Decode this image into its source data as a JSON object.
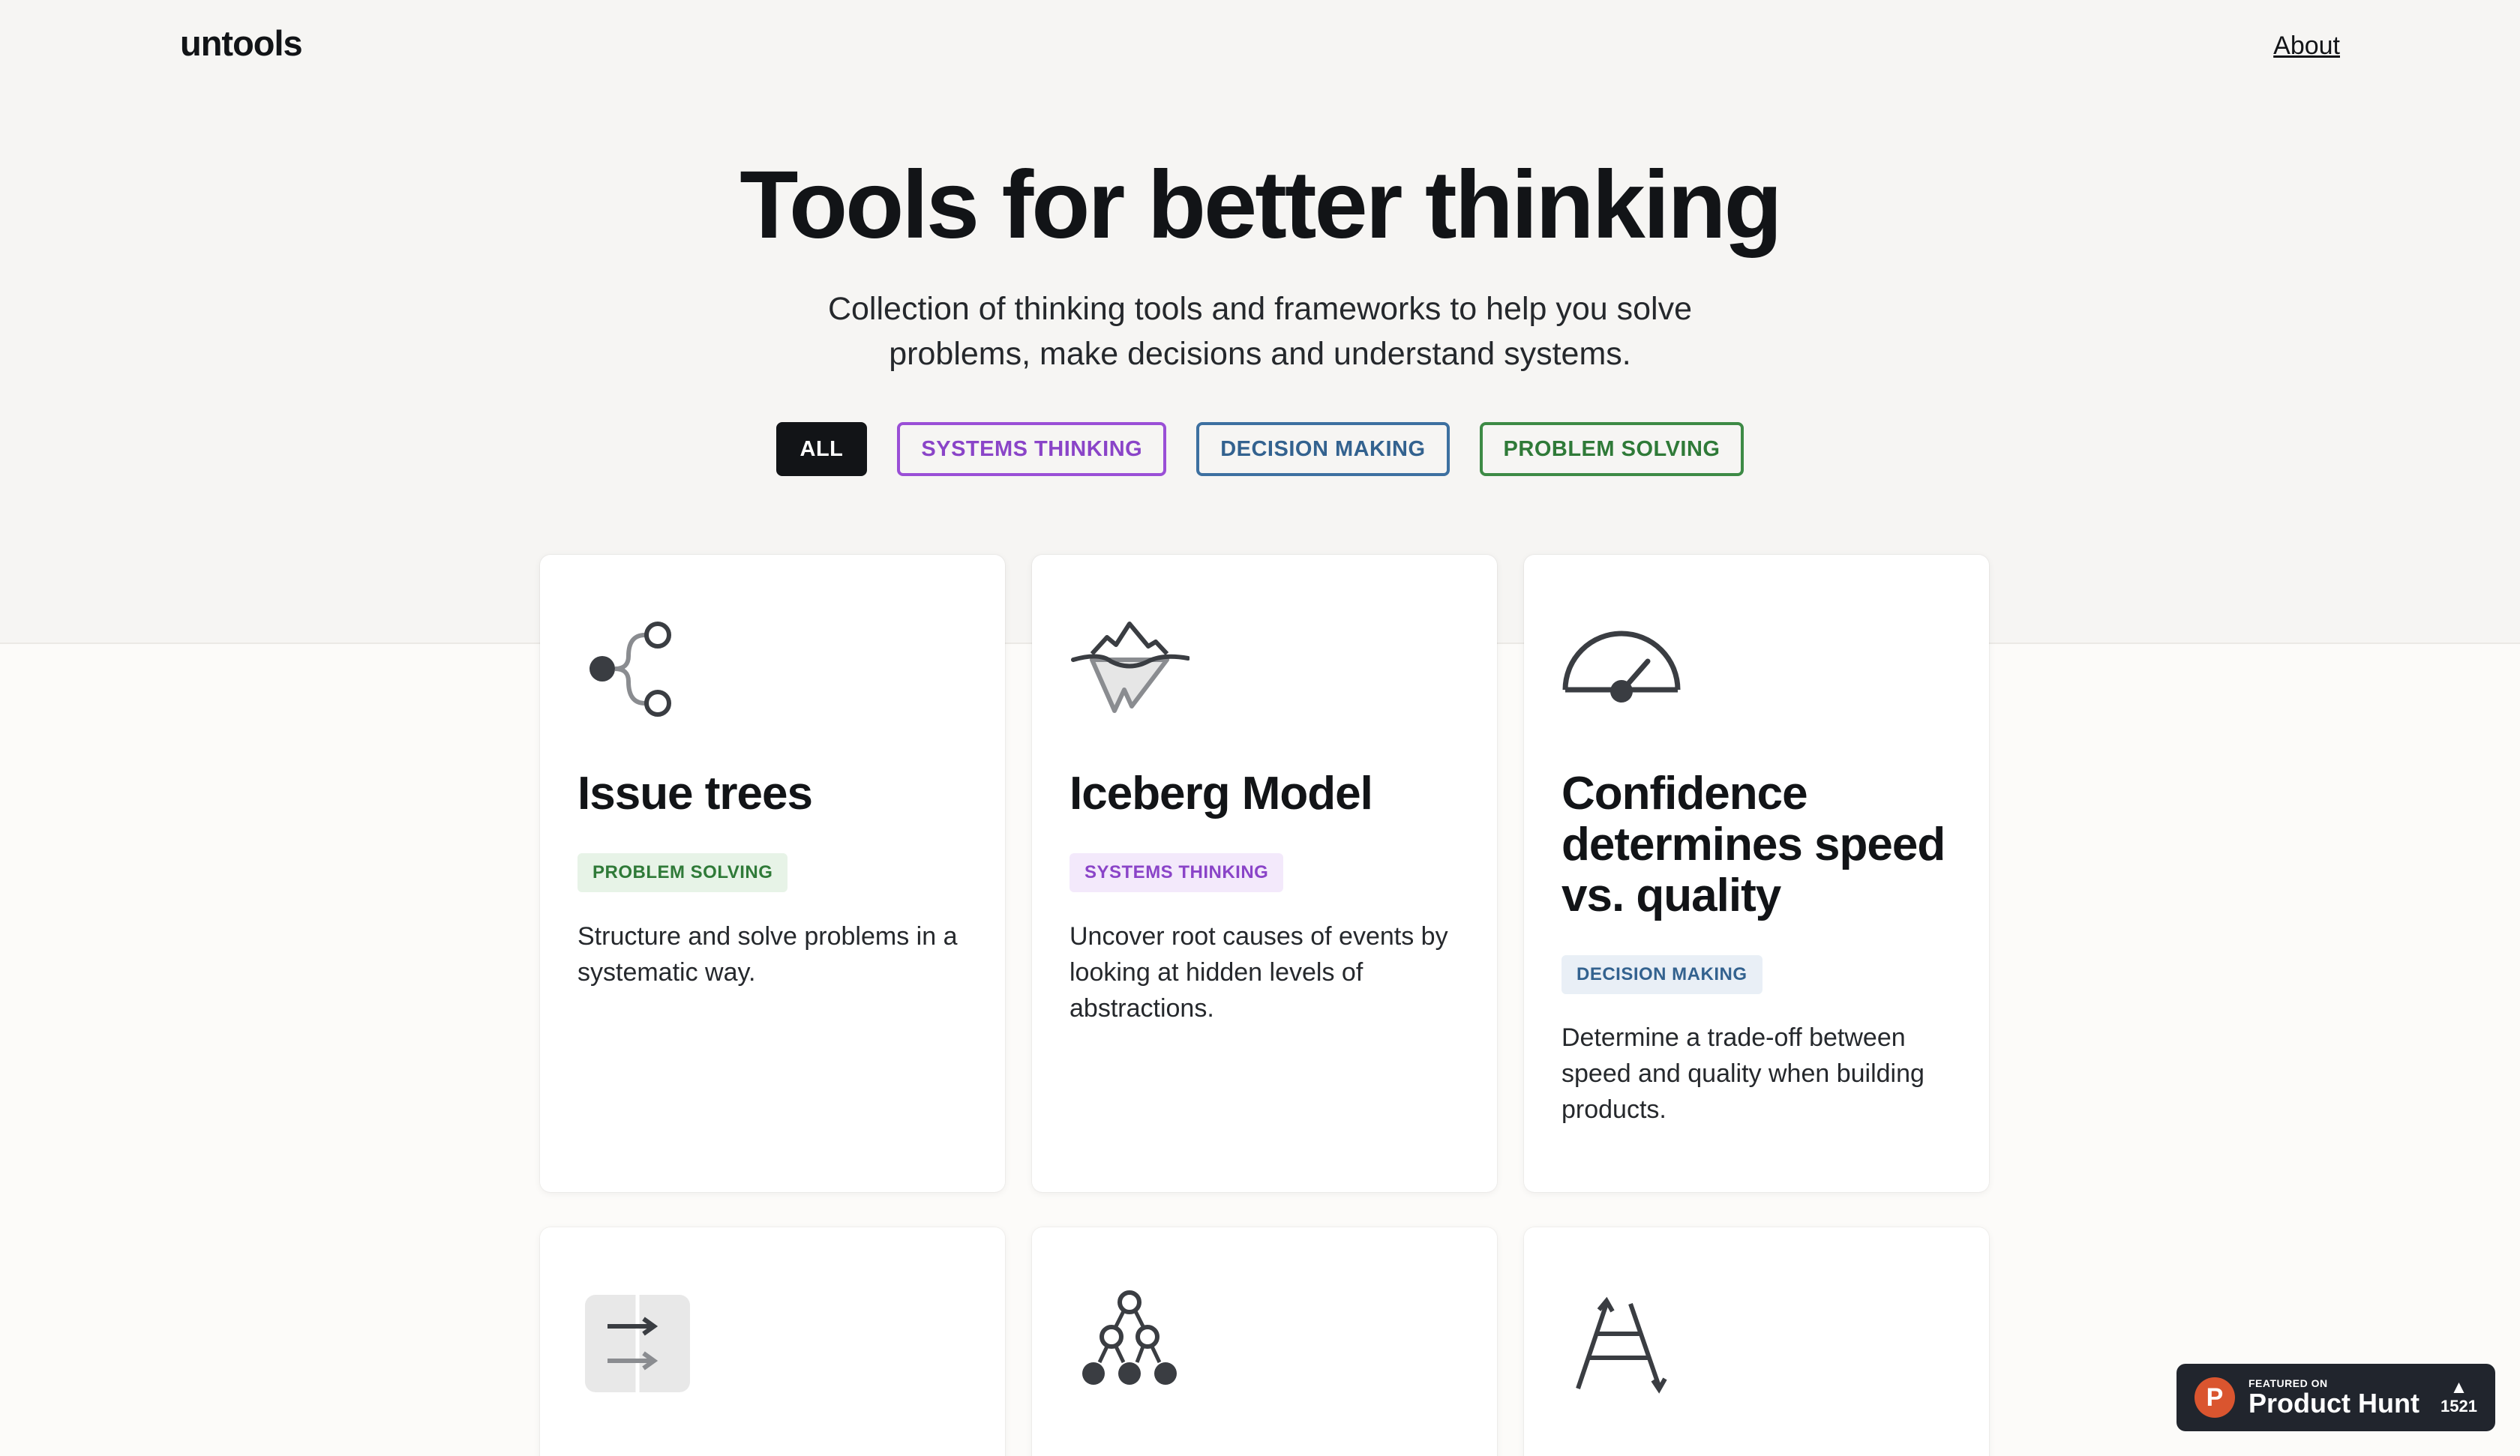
{
  "header": {
    "logo": "untools",
    "about_label": "About"
  },
  "hero": {
    "title": "Tools for better thinking",
    "subtitle": "Collection of thinking tools and frameworks to help you solve problems, make decisions and understand systems."
  },
  "filters": [
    {
      "label": "ALL",
      "active": true
    },
    {
      "label": "SYSTEMS THINKING",
      "color": "#8a44c8"
    },
    {
      "label": "DECISION MAKING",
      "color": "#33628f"
    },
    {
      "label": "PROBLEM SOLVING",
      "color": "#2f7a38"
    }
  ],
  "cards": [
    {
      "icon": "issue-tree-icon",
      "title": "Issue trees",
      "tag": "PROBLEM SOLVING",
      "description": "Structure and solve problems in a systematic way."
    },
    {
      "icon": "iceberg-icon",
      "title": "Iceberg Model",
      "tag": "SYSTEMS THINKING",
      "description": "Uncover root causes of events by looking at hidden levels of abstractions."
    },
    {
      "icon": "speedometer-icon",
      "title": "Confidence determines speed vs. quality",
      "tag": "DECISION MAKING",
      "description": "Determine a trade-off between speed and quality when building products."
    },
    {
      "icon": "two-way-door-icon"
    },
    {
      "icon": "first-principles-tree-icon"
    },
    {
      "icon": "ladder-icon"
    }
  ],
  "product_hunt": {
    "featured_on": "FEATURED ON",
    "name": "Product Hunt",
    "votes": "1521",
    "logo_letter": "P"
  }
}
